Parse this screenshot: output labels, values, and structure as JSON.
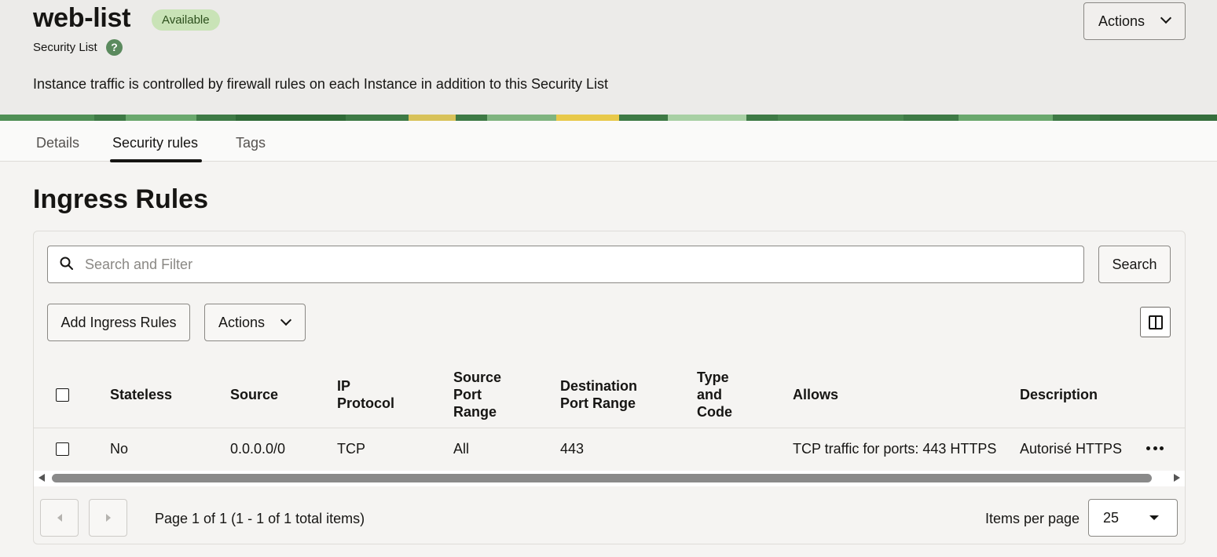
{
  "header": {
    "title": "web-list",
    "status": "Available",
    "subtitle": "Security List",
    "help_icon": "?",
    "info": "Instance traffic is controlled by firewall rules on each Instance in addition to this Security List",
    "actions_label": "Actions"
  },
  "tabs": [
    {
      "label": "Details",
      "active": false
    },
    {
      "label": "Security rules",
      "active": true
    },
    {
      "label": "Tags",
      "active": false
    }
  ],
  "section": {
    "title": "Ingress Rules"
  },
  "search": {
    "placeholder": "Search and Filter",
    "button_label": "Search"
  },
  "toolbar": {
    "add_label": "Add Ingress Rules",
    "actions_label": "Actions"
  },
  "table": {
    "headers": [
      "Stateless",
      "Source",
      "IP Protocol",
      "Source Port Range",
      "Destination Port Range",
      "Type and Code",
      "Allows",
      "Description"
    ],
    "rows": [
      {
        "stateless": "No",
        "source": "0.0.0.0/0",
        "protocol": "TCP",
        "source_port": "All",
        "dest_port": "443",
        "type_code": "",
        "allows": "TCP traffic for ports: 443 HTTPS",
        "description": "Autorisé HTTPS"
      }
    ]
  },
  "pagination": {
    "page_info": "Page 1 of 1 (1 - 1 of 1 total items)",
    "items_per_page_label": "Items per page",
    "items_per_page": "25"
  },
  "colors": {
    "status_badge_bg": "#c9e3b7",
    "help_icon_bg": "#5b8a5e",
    "band": "#3e7a45"
  }
}
